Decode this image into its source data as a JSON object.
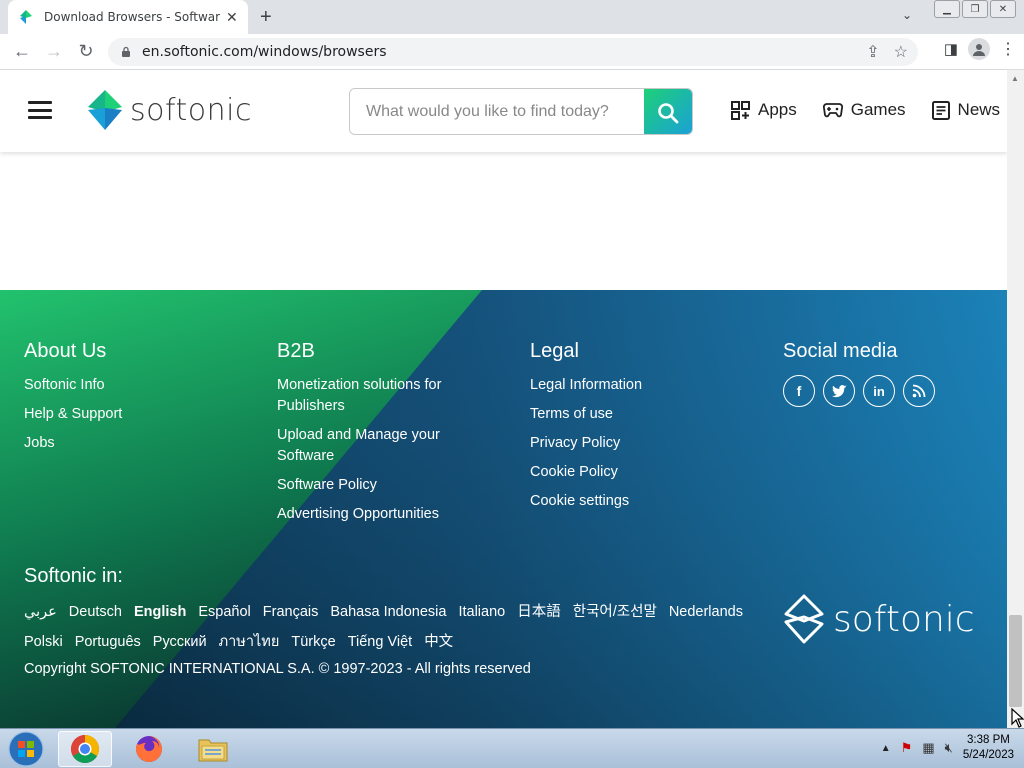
{
  "browser": {
    "tab_title": "Download Browsers - Software f",
    "url": "en.softonic.com/windows/browsers"
  },
  "header": {
    "logo_text": "softonic",
    "search_placeholder": "What would you like to find today?",
    "nav": [
      {
        "label": "Apps",
        "icon": "apps-grid-icon"
      },
      {
        "label": "Games",
        "icon": "gamepad-icon"
      },
      {
        "label": "News",
        "icon": "news-icon"
      }
    ]
  },
  "footer": {
    "about": {
      "title": "About Us",
      "links": [
        "Softonic Info",
        "Help & Support",
        "Jobs"
      ]
    },
    "b2b": {
      "title": "B2B",
      "links": [
        "Monetization solutions for Publishers",
        "Upload and Manage your Software",
        "Software Policy",
        "Advertising Opportunities"
      ]
    },
    "legal": {
      "title": "Legal",
      "links": [
        "Legal Information",
        "Terms of use",
        "Privacy Policy",
        "Cookie Policy",
        "Cookie settings"
      ]
    },
    "social": {
      "title": "Social media",
      "icons": [
        "facebook-icon",
        "twitter-icon",
        "linkedin-icon",
        "rss-icon"
      ]
    },
    "languages_title": "Softonic in:",
    "languages": [
      "عربي",
      "Deutsch",
      "English",
      "Español",
      "Français",
      "Bahasa Indonesia",
      "Italiano",
      "日本語",
      "한국어/조선말",
      "Nederlands",
      "Polski",
      "Português",
      "Русский",
      "ภาษาไทย",
      "Türkçe",
      "Tiếng Việt",
      "中文"
    ],
    "copyright": "Copyright SOFTONIC INTERNATIONAL S.A. © 1997-2023 - All rights reserved",
    "logo_text": "softonic"
  },
  "taskbar": {
    "time": "3:38 PM",
    "date": "5/24/2023"
  },
  "colors": {
    "brand_green": "#1ed078",
    "brand_blue": "#1a7fb5",
    "footer_dark": "#0f3a4f"
  }
}
